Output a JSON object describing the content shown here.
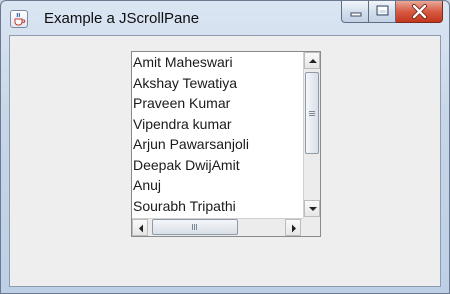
{
  "window": {
    "title": "Example a JScrollPane",
    "icon": "java-cup-icon",
    "controls": [
      "minimize-icon",
      "maximize-icon",
      "close-icon"
    ]
  },
  "list": {
    "items": [
      "Amit Maheswari",
      "Akshay Tewatiya",
      "Praveen Kumar",
      "Vipendra kumar",
      "Arjun Pawarsanjoli",
      "Deepak DwijAmit",
      "Anuj",
      "Sourabh Tripathi"
    ]
  },
  "colors": {
    "close_button": "#d75b42",
    "client_background": "#eeeeee",
    "list_background": "#ffffff"
  }
}
